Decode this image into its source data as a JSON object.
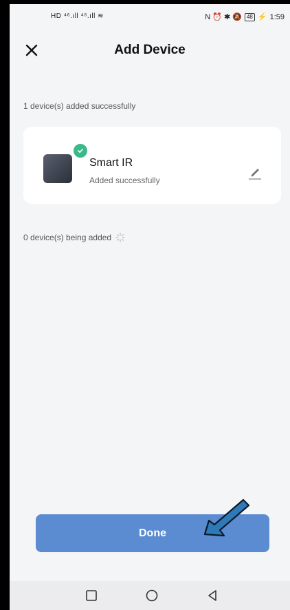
{
  "status_bar": {
    "left_icons": "HD ⁴⁶.ıll ⁴⁶.ıll ≋",
    "right_icons": "N ⏰ ✱ 🔕",
    "battery": "48",
    "time": "1:59"
  },
  "header": {
    "title": "Add Device"
  },
  "added_section": {
    "label": "1 device(s) added successfully"
  },
  "devices": [
    {
      "name": "Smart IR",
      "status": "Added successfully"
    }
  ],
  "adding_section": {
    "label": "0 device(s) being added"
  },
  "done_button": {
    "label": "Done"
  },
  "colors": {
    "accent": "#5b8bd0",
    "success": "#3cb98b",
    "arrow": "#2e7ab8",
    "background": "#f4f5f7"
  },
  "icons": [
    "close-icon",
    "check-icon",
    "edit-icon",
    "spinner-icon",
    "arrow-icon",
    "nav-recents-icon",
    "nav-home-icon",
    "nav-back-icon"
  ]
}
